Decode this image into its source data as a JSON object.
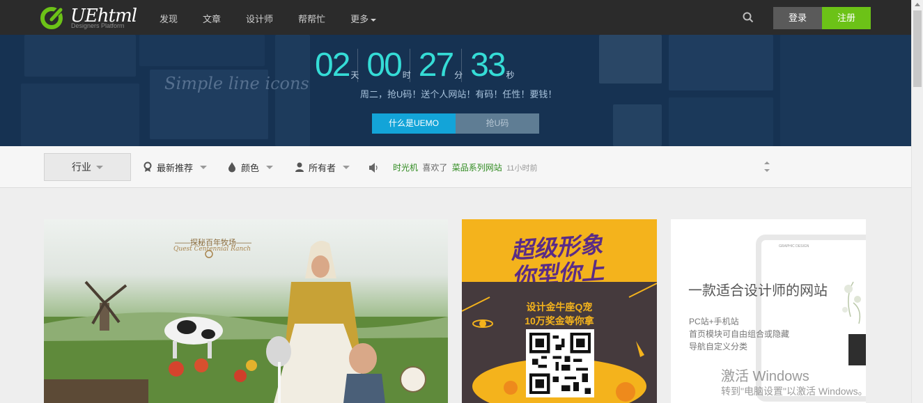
{
  "header": {
    "logo_text": "UEhtml",
    "logo_sub": "Designers Platform",
    "nav": [
      {
        "label": "发现"
      },
      {
        "label": "文章"
      },
      {
        "label": "设计师"
      },
      {
        "label": "帮帮忙"
      },
      {
        "label": "更多"
      }
    ],
    "search_icon": "search-icon",
    "login_label": "登录",
    "register_label": "注册",
    "colors": {
      "bar": "#2b2b2b",
      "register": "#6cc217",
      "login": "#5a5a5a"
    }
  },
  "banner": {
    "countdown": [
      {
        "value": "02",
        "unit": "天"
      },
      {
        "value": "00",
        "unit": "时"
      },
      {
        "value": "27",
        "unit": "分"
      },
      {
        "value": "33",
        "unit": "秒"
      }
    ],
    "decor_text": "Simple line icons",
    "tagline": "周二，抢U码！送个人网站！有码！任性！要钱！",
    "btn_what": "什么是UEMO",
    "btn_grab": "抢U码",
    "colors": {
      "digits": "#35dcd6",
      "btn_what": "#13a4d8",
      "btn_grab": "#5f7d94"
    }
  },
  "filters": {
    "industry": "行业",
    "latest": "最新推荐",
    "color": "颜色",
    "owner": "所有者",
    "icons": {
      "latest": "ribbon-icon",
      "color": "drop-icon",
      "owner": "person-icon",
      "feed": "speaker-icon"
    }
  },
  "feed": {
    "user": "时光机",
    "verb": "喜欢了",
    "work": "菜品系列网站",
    "time": "11小时前"
  },
  "cards": {
    "card1": {
      "title": "——探秘百年牧场——",
      "subtitle": "Quest Centennial Ranch"
    },
    "card2": {
      "headline1": "超级形象",
      "headline2": "你型你上",
      "line1": "设计金牛座Q宠",
      "line2": "10万奖金等你拿"
    },
    "card3": {
      "brand": "GRAPHIC DESIGN",
      "title": "一款适合设计师的网站",
      "lines": [
        "PC站+手机站",
        "首页模块可自由组合或隐藏",
        "导航自定义分类"
      ]
    }
  },
  "watermark": {
    "line1": "激活 Windows",
    "line2": "转到\"电脑设置\"以激活 Windows。"
  }
}
